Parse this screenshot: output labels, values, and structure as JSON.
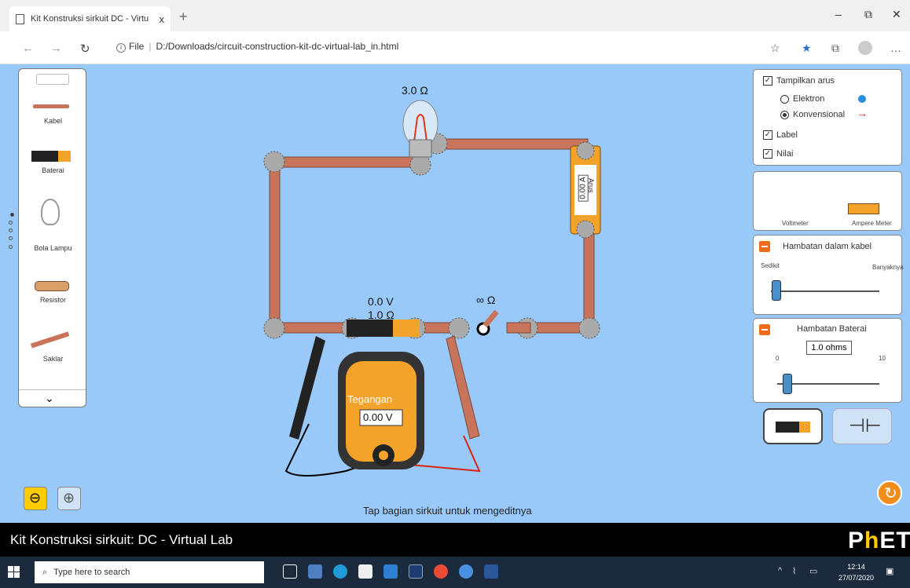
{
  "browser": {
    "tab_title": "Kit Konstruksi sirkuit DC - Virtu",
    "tab_close": "x",
    "new_tab": "+",
    "address_prefix": "File",
    "address": "D:/Downloads/circuit-construction-kit-dc-virtual-lab_in.html",
    "window_controls": [
      "–",
      "⧉",
      "✕"
    ]
  },
  "toolbox": {
    "items": [
      {
        "label": "Kabel",
        "icon": "wire-icon"
      },
      {
        "label": "Baterai",
        "icon": "battery-icon"
      },
      {
        "label": "Bola Lampu",
        "icon": "lightbulb-icon"
      },
      {
        "label": "Resistor",
        "icon": "resistor-icon"
      },
      {
        "label": "Saklar",
        "icon": "switch-icon"
      }
    ]
  },
  "circuit": {
    "bulb_label": "3.0 Ω",
    "ammeter_label": "Arus",
    "ammeter_value": "0.00 A",
    "battery_voltage": "0.0 V",
    "battery_resistance": "1.0 Ω",
    "switch_label": "∞ Ω",
    "voltmeter_title": "Tegangan",
    "voltmeter_value": "0.00 V"
  },
  "panel_display": {
    "show_current": "Tampilkan arus",
    "electron": "Elektron",
    "conventional": "Konvensional",
    "label": "Label",
    "values": "Nilai"
  },
  "panel_meters": {
    "voltmeter": "Voltmeter",
    "ammeter": "Ampere Meter"
  },
  "panel_wire_resistance": {
    "title": "Hambatan dalam kabel",
    "min": "Sedikit",
    "max": "Banyaknya",
    "level": 0.05
  },
  "panel_battery_resistance": {
    "title": "Hambatan Baterai",
    "value": "1.0 ohms",
    "min": "0",
    "max": "10",
    "level": 0.1
  },
  "hint": "Tap bagian sirkuit untuk mengeditnya",
  "footer": {
    "title": "Kit Konstruksi sirkuit: DC - Virtual Lab",
    "logo_p": "P",
    "logo_h": "h",
    "logo_rest": "ET"
  },
  "taskbar": {
    "search_placeholder": "Type here to search",
    "time": "12:14",
    "date": "27/07/2020"
  },
  "colors": {
    "sim_bg": "#99c9f9",
    "wire": "#c7745a",
    "accent": "#f06a1a"
  }
}
